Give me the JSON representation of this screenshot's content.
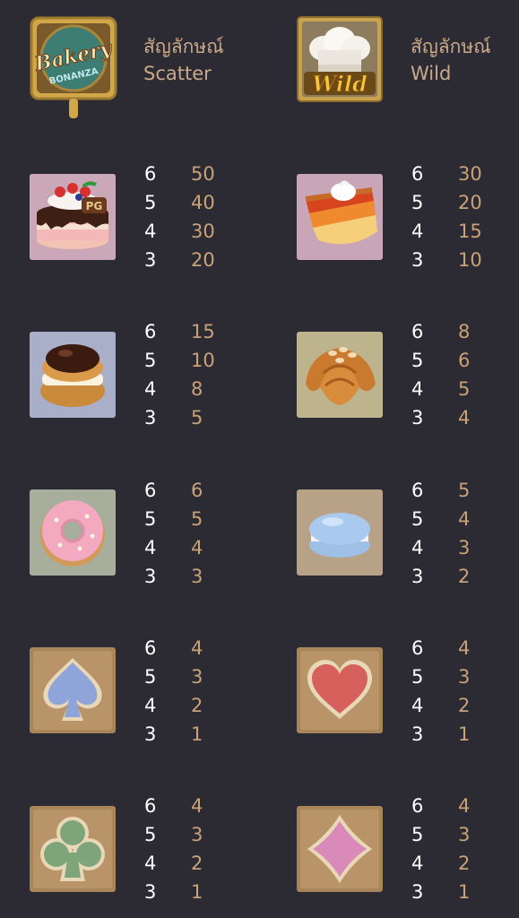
{
  "colors": {
    "background": "#2c2b34",
    "count_text": "#ffffff",
    "payout_text": "#c9a277",
    "label_text": "#c9a98a"
  },
  "special": {
    "scatter": {
      "icon": "bakery-bonanza-logo",
      "logo_text": "Bakery",
      "logo_sub": "BONANZA",
      "label_th": "สัญลักษณ์",
      "label_en": "Scatter"
    },
    "wild": {
      "icon": "chef-hat-wild",
      "logo_text": "Wild",
      "label_th": "สัญลักษณ์",
      "label_en": "Wild"
    }
  },
  "symbols": [
    {
      "icon": "cake-icon",
      "badge": "PG",
      "payouts": [
        {
          "count": "6",
          "value": "50"
        },
        {
          "count": "5",
          "value": "40"
        },
        {
          "count": "4",
          "value": "30"
        },
        {
          "count": "3",
          "value": "20"
        }
      ]
    },
    {
      "icon": "pie-slice-icon",
      "payouts": [
        {
          "count": "6",
          "value": "30"
        },
        {
          "count": "5",
          "value": "20"
        },
        {
          "count": "4",
          "value": "15"
        },
        {
          "count": "3",
          "value": "10"
        }
      ]
    },
    {
      "icon": "cream-puff-icon",
      "payouts": [
        {
          "count": "6",
          "value": "15"
        },
        {
          "count": "5",
          "value": "10"
        },
        {
          "count": "4",
          "value": "8"
        },
        {
          "count": "3",
          "value": "5"
        }
      ]
    },
    {
      "icon": "croissant-icon",
      "payouts": [
        {
          "count": "6",
          "value": "8"
        },
        {
          "count": "5",
          "value": "6"
        },
        {
          "count": "4",
          "value": "5"
        },
        {
          "count": "3",
          "value": "4"
        }
      ]
    },
    {
      "icon": "donut-icon",
      "payouts": [
        {
          "count": "6",
          "value": "6"
        },
        {
          "count": "5",
          "value": "5"
        },
        {
          "count": "4",
          "value": "4"
        },
        {
          "count": "3",
          "value": "3"
        }
      ]
    },
    {
      "icon": "macaron-icon",
      "payouts": [
        {
          "count": "6",
          "value": "5"
        },
        {
          "count": "5",
          "value": "4"
        },
        {
          "count": "4",
          "value": "3"
        },
        {
          "count": "3",
          "value": "2"
        }
      ]
    },
    {
      "icon": "spade-icon",
      "payouts": [
        {
          "count": "6",
          "value": "4"
        },
        {
          "count": "5",
          "value": "3"
        },
        {
          "count": "4",
          "value": "2"
        },
        {
          "count": "3",
          "value": "1"
        }
      ]
    },
    {
      "icon": "heart-icon",
      "payouts": [
        {
          "count": "6",
          "value": "4"
        },
        {
          "count": "5",
          "value": "3"
        },
        {
          "count": "4",
          "value": "2"
        },
        {
          "count": "3",
          "value": "1"
        }
      ]
    },
    {
      "icon": "club-icon",
      "payouts": [
        {
          "count": "6",
          "value": "4"
        },
        {
          "count": "5",
          "value": "3"
        },
        {
          "count": "4",
          "value": "2"
        },
        {
          "count": "3",
          "value": "1"
        }
      ]
    },
    {
      "icon": "diamond-icon",
      "payouts": [
        {
          "count": "6",
          "value": "4"
        },
        {
          "count": "5",
          "value": "3"
        },
        {
          "count": "4",
          "value": "2"
        },
        {
          "count": "3",
          "value": "1"
        }
      ]
    }
  ]
}
